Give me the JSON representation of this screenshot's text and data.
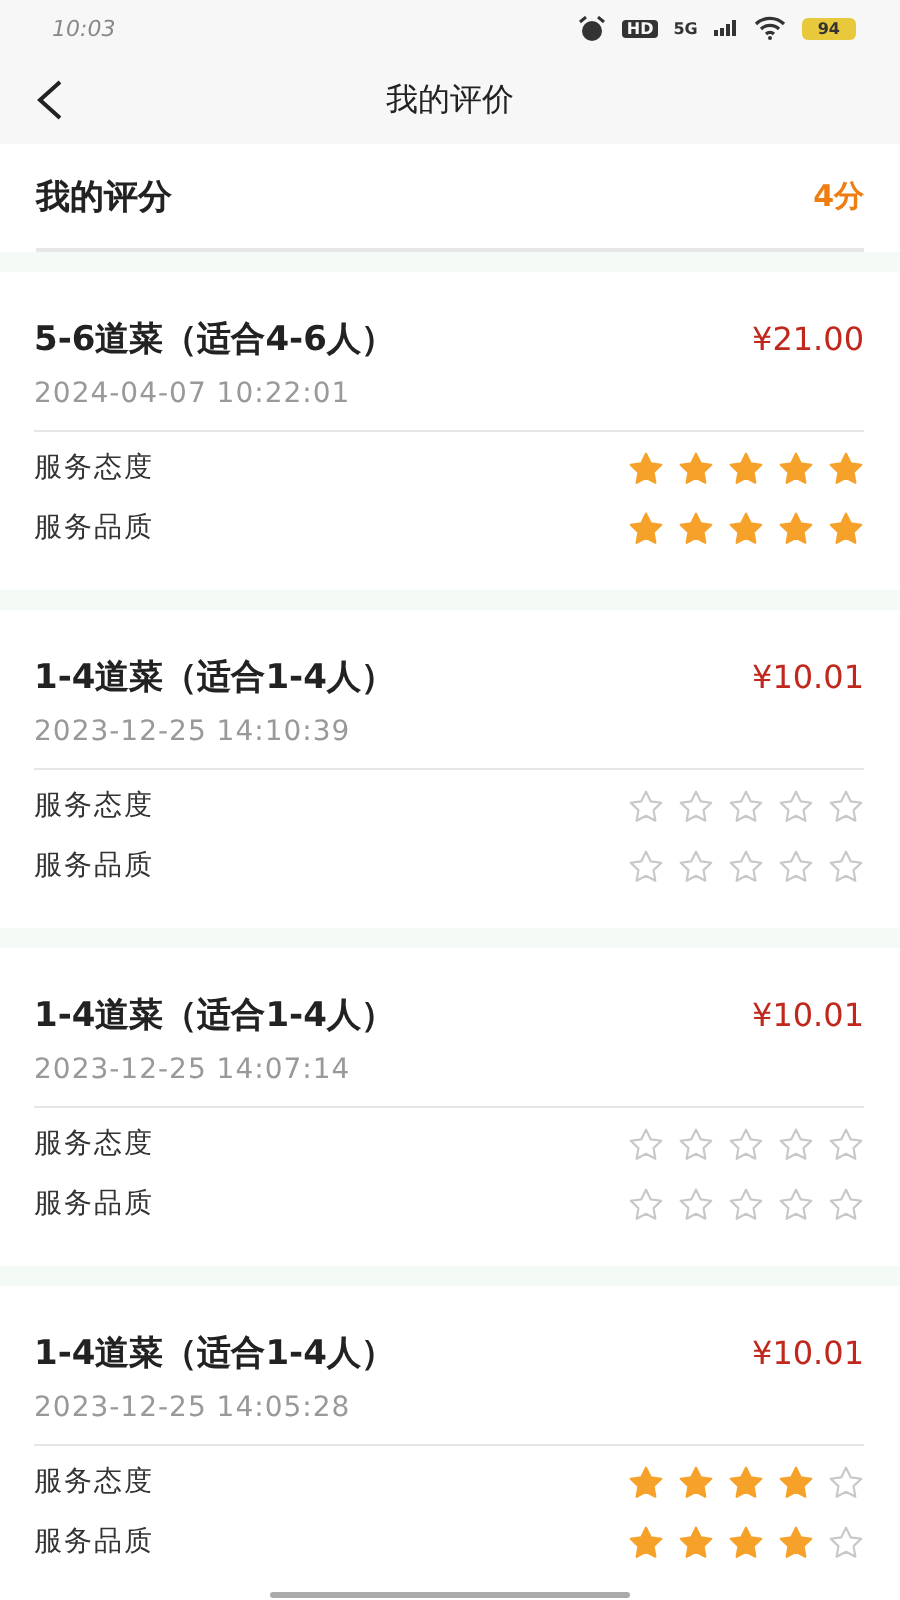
{
  "status_bar": {
    "time": "10:03",
    "network_type": "5G",
    "hd": "HD",
    "battery": "94"
  },
  "nav": {
    "title": "我的评价"
  },
  "summary": {
    "label": "我的评分",
    "score": "4分"
  },
  "reviews": [
    {
      "title": "5-6道菜（适合4-6人）",
      "price": "¥21.00",
      "time": "2024-04-07 10:22:01",
      "ratings": [
        {
          "label": "服务态度",
          "stars": 5
        },
        {
          "label": "服务品质",
          "stars": 5
        }
      ]
    },
    {
      "title": "1-4道菜（适合1-4人）",
      "price": "¥10.01",
      "time": "2023-12-25 14:10:39",
      "ratings": [
        {
          "label": "服务态度",
          "stars": 0
        },
        {
          "label": "服务品质",
          "stars": 0
        }
      ]
    },
    {
      "title": "1-4道菜（适合1-4人）",
      "price": "¥10.01",
      "time": "2023-12-25 14:07:14",
      "ratings": [
        {
          "label": "服务态度",
          "stars": 0
        },
        {
          "label": "服务品质",
          "stars": 0
        }
      ]
    },
    {
      "title": "1-4道菜（适合1-4人）",
      "price": "¥10.01",
      "time": "2023-12-25 14:05:28",
      "ratings": [
        {
          "label": "服务态度",
          "stars": 4
        },
        {
          "label": "服务品质",
          "stars": 4
        }
      ]
    }
  ]
}
